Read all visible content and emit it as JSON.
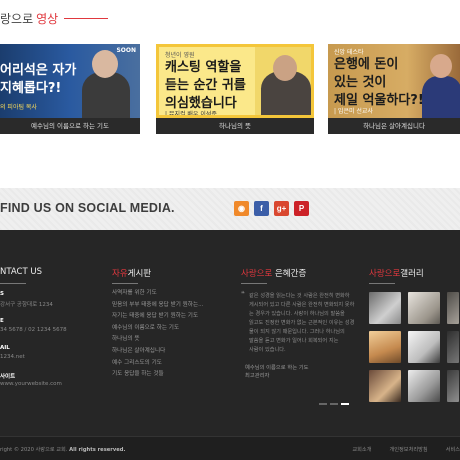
{
  "video_section": {
    "title_prefix": "랑으로",
    "title_highlight": "영상",
    "videos": [
      {
        "headline_1": "어리석은 자가",
        "headline_2": "지혜롭다?!",
        "sub": "의 피아팀 목사",
        "brand": "SOON",
        "caption": "예수님의 이름으로 하는 기도"
      },
      {
        "logo": "청년이 영원",
        "headline_1": "캐스팅 역할을",
        "headline_2": "듣는 순간 귀를",
        "headline_3": "의심했습니다",
        "sub": "| 뮤지컬 배우 이석준",
        "caption": "하나님의 뜻"
      },
      {
        "logo": "신앙 테스타",
        "headline_1": "은행에 돈이",
        "headline_2": "있는 것이",
        "headline_3": "제일 억울하다?!",
        "sub": "| 임은미 선교사",
        "caption": "하나님은 살아계십니다"
      }
    ]
  },
  "social": {
    "title": "FIND US ON SOCIAL MEDIA.",
    "icons": [
      "rss-icon",
      "facebook-icon",
      "google-plus-icon",
      "pinterest-icon"
    ],
    "icon_glyphs": [
      "◉",
      "f",
      "g+",
      "P"
    ]
  },
  "footer": {
    "contact": {
      "heading_red": "",
      "heading": "NTACT US",
      "address_label": "S",
      "address": "강서구 공항대로 1234",
      "phone_label": "E",
      "phone": "34 5678 / 02 1234 5678",
      "email_label": "AIL",
      "email": "1234.net",
      "web_label": "사이트",
      "web": "www.yourwebsite.com"
    },
    "board": {
      "heading_red": "자유",
      "heading": "게시판",
      "items": [
        "사역자를 위한 기도",
        "믿음의 부부 태중에 응답 받기 원하는...",
        "자기는 태중에 응답 받기 원하는 기도",
        "예수님의 이름으로 하는 기도",
        "하나님의 뜻",
        "하나님은 살아계십니다",
        "예수 그리스도의 기도",
        "기도 응답을 하는 것들"
      ]
    },
    "testimony": {
      "heading_red": "사랑으로",
      "heading": " 은혜간증",
      "lines": [
        "같은 성경을 읽는다는 것 사람은 완전히 변화하",
        "게시되어 있고 다른 사람은 완전히 변화되지 못하",
        "는 경우가 있습니다. 사랑이 하나님의 말씀을",
        "읽고도 진정한 변화가 없는 근본적인 이유는 성경",
        "물이 되지 않기 때문입니다. 그러나 하나님의",
        "말씀을 듣고 변화가 일어나 회복되어 지는",
        "사람이 있습니다."
      ],
      "author_1": "예수님의 이름으로 하는 기도",
      "author_2": "최고관리자"
    },
    "gallery": {
      "heading_red": "사랑으로",
      "heading": "갤러리"
    },
    "copyright_prefix": "right © 2020 사랑으로 교회.",
    "copyright_bold": "All rights reserved.",
    "bottom_links": [
      "교회소개",
      "개인정보처리방침",
      "서비스"
    ]
  }
}
